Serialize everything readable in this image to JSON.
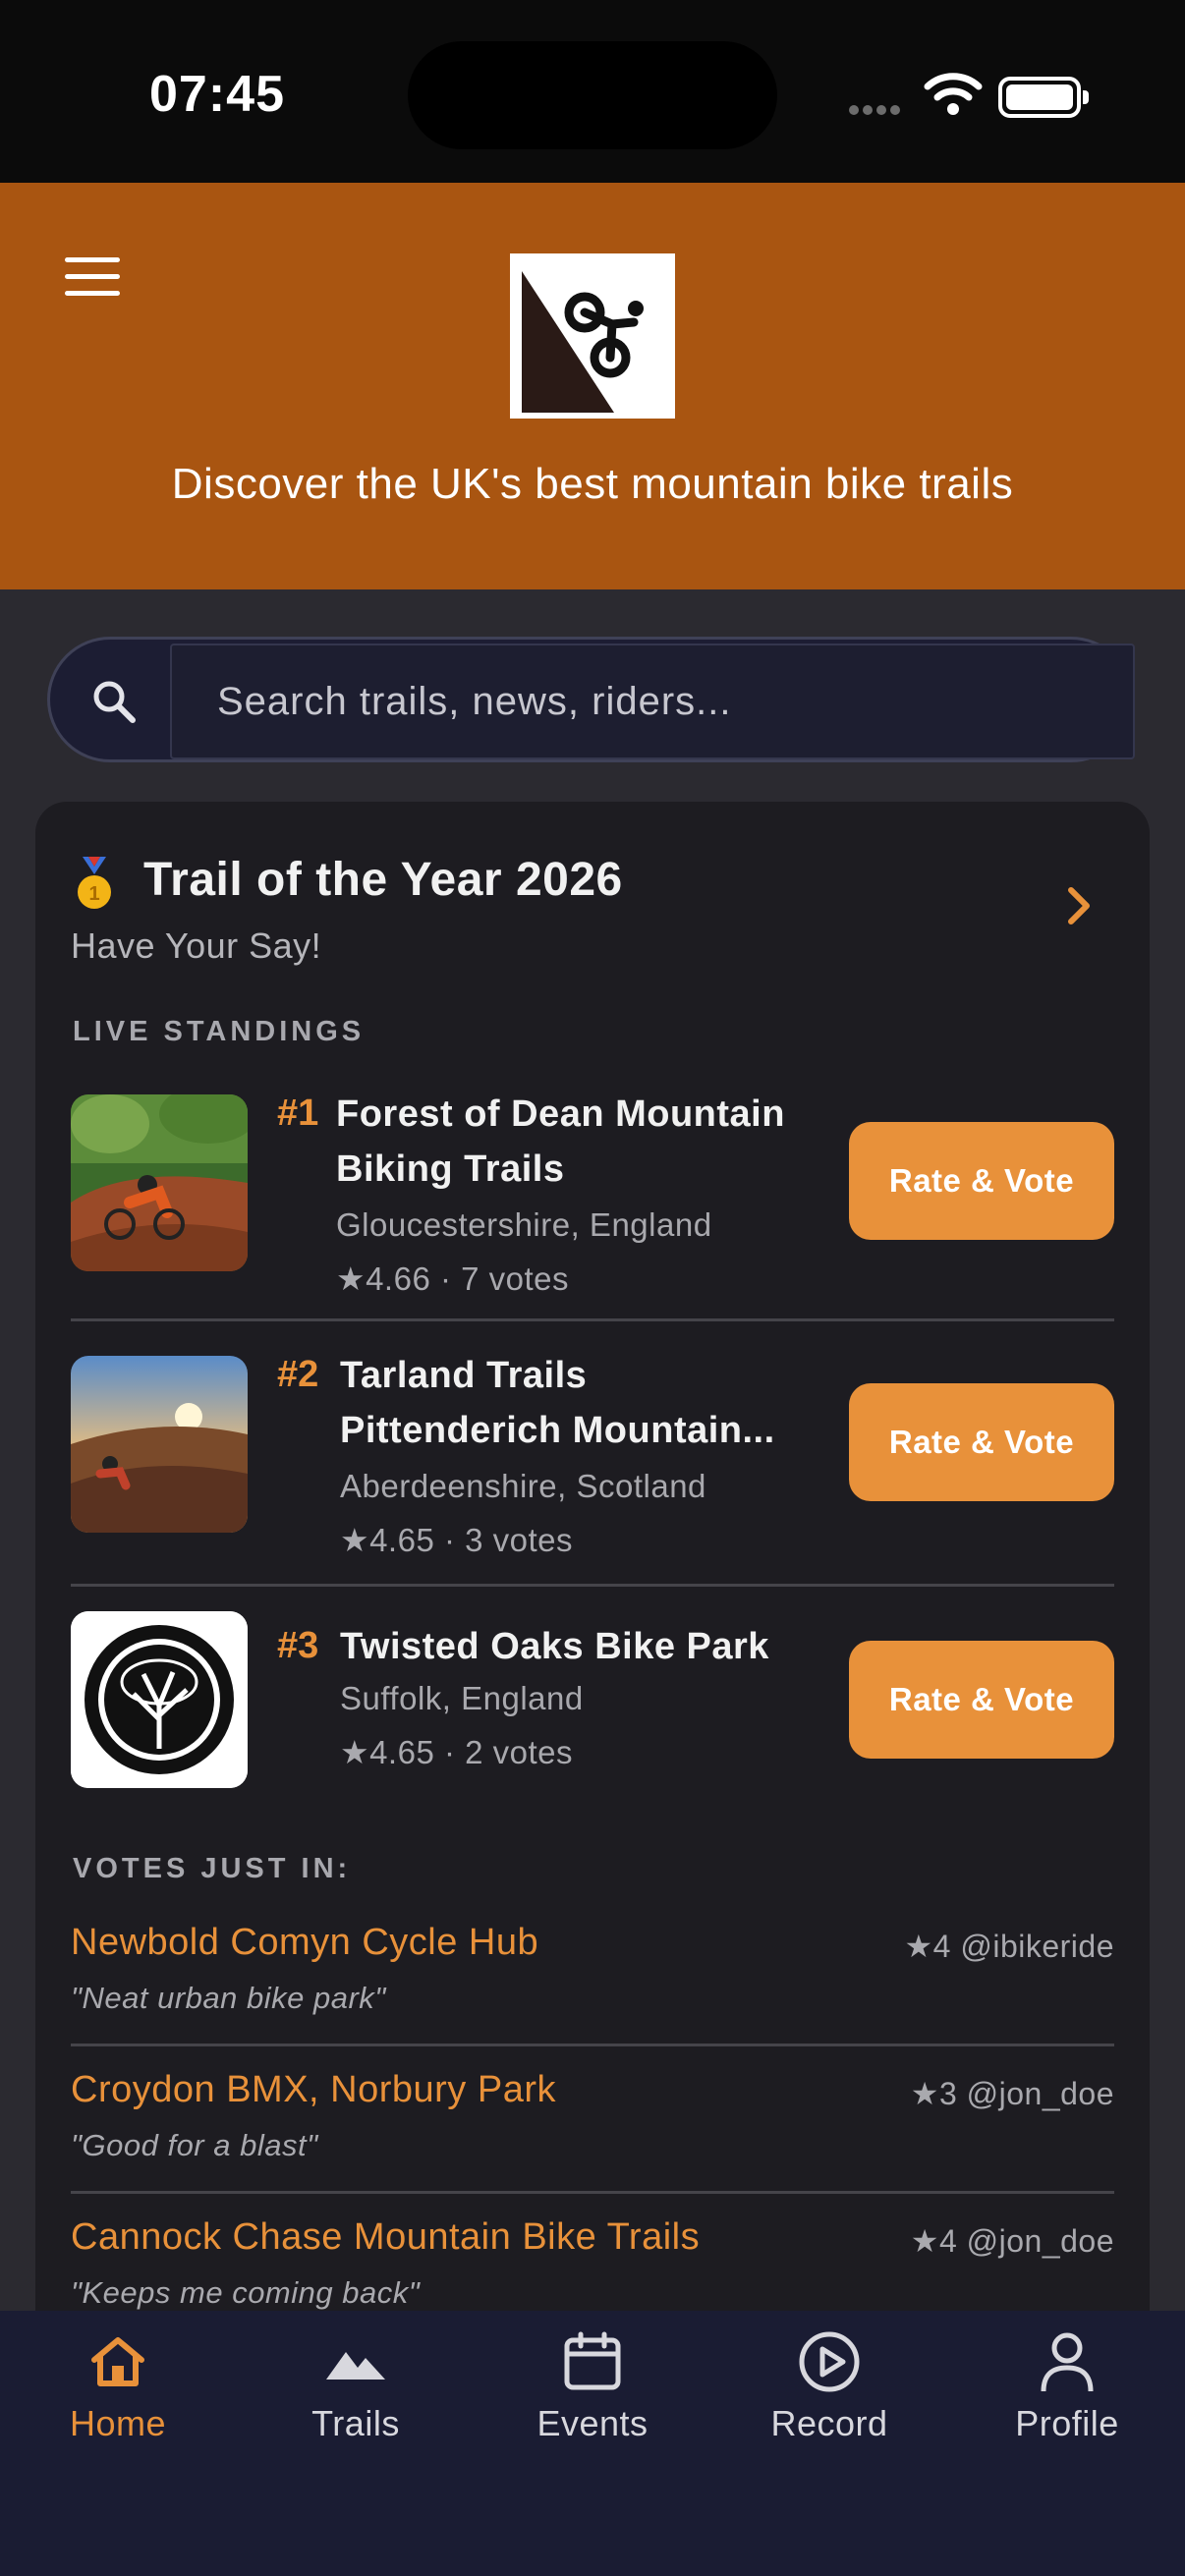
{
  "status": {
    "time": "07:45"
  },
  "header": {
    "tagline": "Discover the UK's best mountain bike trails"
  },
  "search": {
    "placeholder": "Search trails, news, riders..."
  },
  "toty": {
    "title": "Trail of the Year 2026",
    "subtitle": "Have Your Say!",
    "standings_label": "LIVE STANDINGS",
    "vote_label": "Rate & Vote",
    "standings": [
      {
        "rank": "#1",
        "name_line1": "Forest of Dean Mountain",
        "name_line2": "Biking Trails",
        "location": "Gloucestershire, England",
        "rating": "★4.66 · 7 votes"
      },
      {
        "rank": "#2",
        "name_line1": "Tarland Trails",
        "name_line2": "Pittenderich Mountain...",
        "location": "Aberdeenshire, Scotland",
        "rating": "★4.65 · 3 votes"
      },
      {
        "rank": "#3",
        "name_line1": "Twisted Oaks Bike Park",
        "location": "Suffolk, England",
        "rating": "★4.65 · 2 votes"
      }
    ],
    "votes_label": "VOTES JUST IN:",
    "votes": [
      {
        "trail": "Newbold Comyn Cycle Hub",
        "meta": "★4  @ibikeride",
        "quote": "\"Neat urban bike park\""
      },
      {
        "trail": "Croydon BMX, Norbury Park",
        "meta": "★3  @jon_doe",
        "quote": "\"Good for a blast\""
      },
      {
        "trail": "Cannock Chase Mountain Bike Trails",
        "meta": "★4  @jon_doe",
        "quote": "\"Keeps me coming back\""
      }
    ]
  },
  "nav": [
    {
      "label": "Home",
      "icon": "home-icon",
      "active": true
    },
    {
      "label": "Trails",
      "icon": "mountain-icon"
    },
    {
      "label": "Events",
      "icon": "calendar-icon"
    },
    {
      "label": "Record",
      "icon": "play-circle-icon"
    },
    {
      "label": "Profile",
      "icon": "person-icon"
    }
  ],
  "colors": {
    "accent": "#e8913a",
    "header": "#a95511",
    "card": "#1d1c21",
    "nav": "#1a1c33"
  }
}
